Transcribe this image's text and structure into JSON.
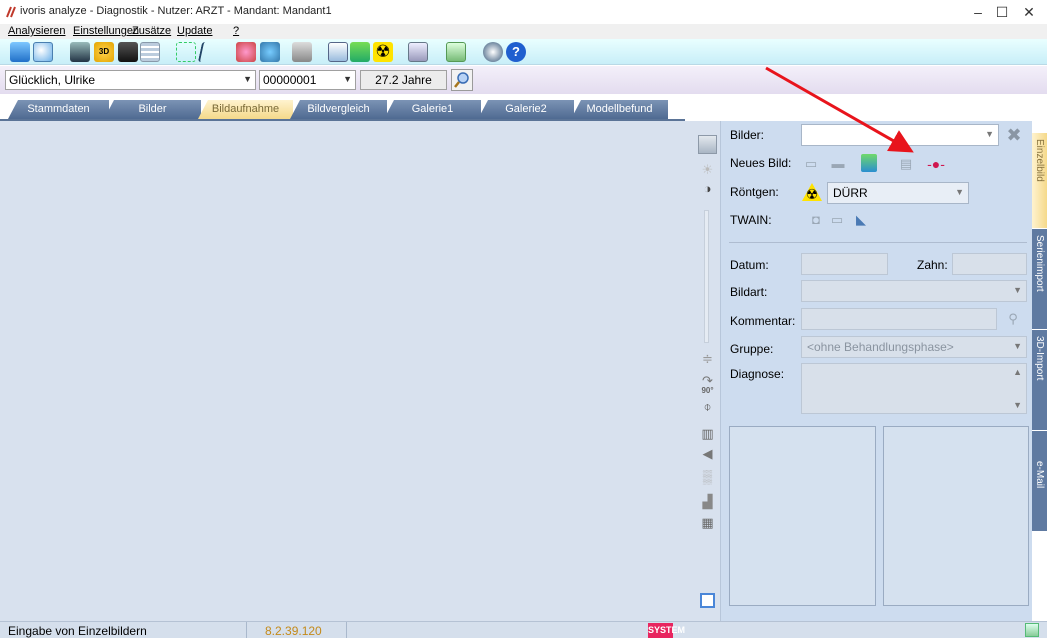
{
  "window": {
    "title": "ivoris analyze - Diagnostik - Nutzer: ARZT - Mandant: Mandant1",
    "minimize": "–",
    "maximize": "☐",
    "close": "✕"
  },
  "menu": [
    "Analysieren",
    "Einstellungen",
    "Zusätze",
    "Update",
    "?"
  ],
  "patient": {
    "name": "Glücklich, Ulrike",
    "number": "00000001",
    "age": "27.2 Jahre"
  },
  "tabs": [
    "Stammdaten",
    "Bilder",
    "Bildaufnahme",
    "Bildvergleich",
    "Galerie1",
    "Galerie2",
    "Modellbefund"
  ],
  "active_tab": "Bildaufnahme",
  "panel": {
    "bilder_label": "Bilder:",
    "bilder_value": "",
    "neues_bild_label": "Neues Bild:",
    "roentgen_label": "Röntgen:",
    "roentgen_value": "DÜRR",
    "twain_label": "TWAIN:",
    "datum_label": "Datum:",
    "datum_value": "",
    "zahn_label": "Zahn:",
    "zahn_value": "",
    "bildart_label": "Bildart:",
    "bildart_value": "",
    "kommentar_label": "Kommentar:",
    "kommentar_value": "",
    "gruppe_label": "Gruppe:",
    "gruppe_value": "<ohne Behandlungsphase>",
    "diagnose_label": "Diagnose:",
    "diagnose_value": ""
  },
  "side_tabs": [
    "Einzelbild",
    "Serienimport",
    "3D-Import",
    "e-Mail"
  ],
  "toolstrip": {
    "rotate_label": "90°"
  },
  "status": {
    "text": "Eingabe von Einzelbildern",
    "version": "8.2.39.120",
    "badge": "SYSTEM"
  },
  "colors": {
    "tab_blue": "#5b7497",
    "tab_active": "#f5d98a",
    "panel_bg": "#cddcef",
    "annotation_arrow": "#e8141c",
    "system_badge": "#e8255f"
  }
}
